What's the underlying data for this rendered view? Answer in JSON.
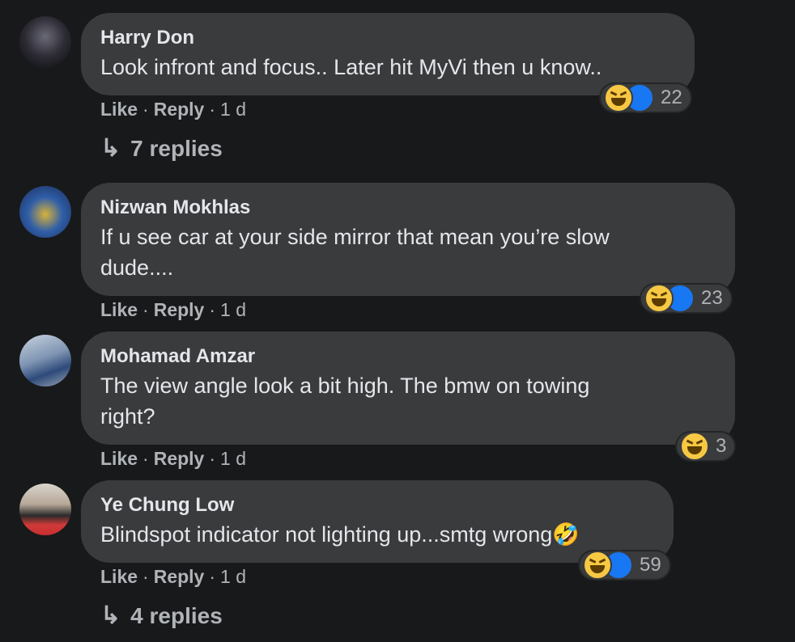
{
  "comments": [
    {
      "author": "Harry Don",
      "text": "Look infront and focus.. Later hit MyVi then u know..",
      "like_label": "Like",
      "reply_label": "Reply",
      "time": "1 d",
      "reaction_count": "22",
      "replies_label": "7 replies"
    },
    {
      "author": "Nizwan Mokhlas",
      "text_line1": "If u see car at your side mirror that mean you’re slow",
      "text_line2": "dude....",
      "like_label": "Like",
      "reply_label": "Reply",
      "time": "1 d",
      "reaction_count": "23"
    },
    {
      "author": "Mohamad Amzar",
      "text_line1": "The view angle look a bit high. The bmw on towing",
      "text_line2": "right?",
      "like_label": "Like",
      "reply_label": "Reply",
      "time": "1 d",
      "reaction_count": "3"
    },
    {
      "author": "Ye Chung Low",
      "text": "Blindspot indicator not lighting up...smtg wrong",
      "like_label": "Like",
      "reply_label": "Reply",
      "time": "1 d",
      "reaction_count": "59",
      "replies_label": "4 replies"
    }
  ],
  "separator": "·",
  "icons": {
    "reply_arrow": "↳",
    "like": "👍",
    "rofl": "🤣"
  },
  "colors": {
    "background": "#18191a",
    "bubble": "#3a3b3c",
    "secondary_text": "#b0b3b8",
    "like_blue": "#1877f2",
    "haha_yellow": "#f7c843"
  }
}
